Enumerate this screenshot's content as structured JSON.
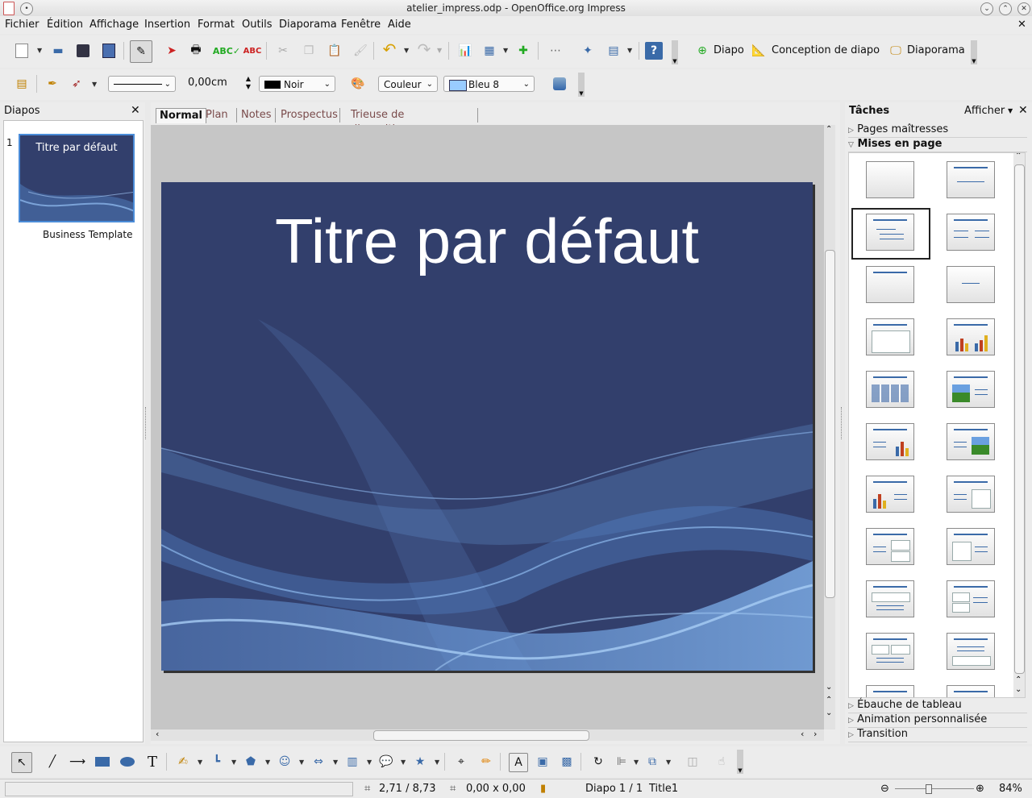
{
  "window": {
    "title": "atelier_impress.odp - OpenOffice.org Impress"
  },
  "menu": [
    "Fichier",
    "Édition",
    "Affichage",
    "Insertion",
    "Format",
    "Outils",
    "Diaporama",
    "Fenêtre",
    "Aide"
  ],
  "toolbar": {
    "new_slide_label": "Diapo",
    "slide_design_label": "Conception de diapo",
    "slideshow_label": "Diaporama"
  },
  "drawing_props": {
    "line_width": "0,00cm",
    "line_color": "Noir",
    "area_style": "Couleur",
    "area_color": "Bleu 8",
    "area_color_swatch": "#99ccff",
    "line_color_swatch": "#000000"
  },
  "slides_panel": {
    "title": "Diapos",
    "slides": [
      {
        "number": "1",
        "thumb_title": "Titre par défaut",
        "master_name": "Business Template"
      }
    ]
  },
  "view_tabs": [
    "Normal",
    "Plan",
    "Notes",
    "Prospectus",
    "Trieuse de diapositives"
  ],
  "slide": {
    "title": "Titre par défaut",
    "bg_color": "#323f6c"
  },
  "tasks_panel": {
    "title": "Tâches",
    "view_menu": "Afficher",
    "sections": {
      "master_pages": "Pages maîtresses",
      "layouts": "Mises en page",
      "table_design": "Ébauche de tableau",
      "custom_animation": "Animation personnalisée",
      "transition": "Transition"
    }
  },
  "status": {
    "position": "2,71 / 8,73",
    "size": "0,00 x 0,00",
    "slide_info": "Diapo 1 / 1",
    "master": "Title1",
    "zoom": "84%"
  },
  "colors": {
    "accent_blue": "#3a6aa8",
    "selection_blue": "#4a8cd8"
  }
}
